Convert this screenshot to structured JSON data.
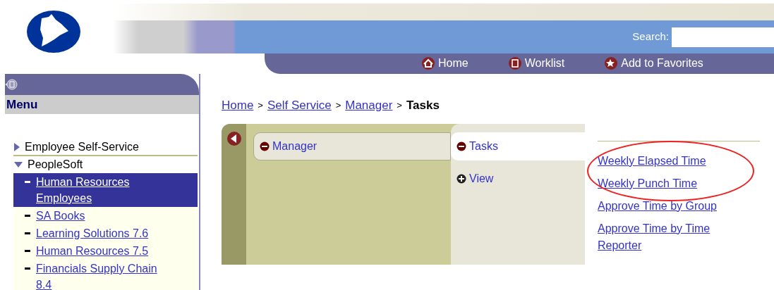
{
  "header": {
    "search": {
      "label": "Search:"
    }
  },
  "nav": [
    {
      "label": "Home",
      "kind": "home"
    },
    {
      "label": "Worklist",
      "kind": "worklist"
    },
    {
      "label": "Add to Favorites",
      "kind": "favorites"
    }
  ],
  "sidebar": {
    "title": "Menu",
    "items": [
      {
        "label": "Employee Self-Service",
        "expanded": false
      },
      {
        "label": "PeopleSoft",
        "expanded": true,
        "children": [
          {
            "label": "Human Resources Employees",
            "selected": true
          },
          {
            "label": "SA Books",
            "selected": false
          },
          {
            "label": "Learning Solutions 7.6",
            "selected": false
          },
          {
            "label": "Human Resources 7.5",
            "selected": false
          },
          {
            "label": "Financials Supply Chain 8.4",
            "selected": false
          }
        ]
      }
    ]
  },
  "breadcrumb": [
    {
      "label": "Home",
      "kind": "link"
    },
    {
      "label": ">",
      "kind": "separator"
    },
    {
      "label": "Self Service",
      "kind": "link"
    },
    {
      "label": ">",
      "kind": "separator"
    },
    {
      "label": "Manager",
      "kind": "link"
    },
    {
      "label": ">",
      "kind": "separator"
    },
    {
      "label": "Tasks",
      "kind": "current"
    }
  ],
  "columns": [
    {
      "folders": [
        {
          "label": "Manager",
          "expanded": true,
          "selected": false
        }
      ]
    },
    {
      "folders": [
        {
          "label": "Tasks",
          "expanded": true,
          "selected": true
        },
        {
          "label": "View",
          "expanded": false,
          "selected": false
        }
      ]
    }
  ],
  "tasks": [
    {
      "label": "Weekly Elapsed Time",
      "highlighted": true
    },
    {
      "label": "Weekly Punch Time",
      "highlighted": true
    },
    {
      "label": "Approve Time by Group",
      "highlighted": false
    },
    {
      "label": "Approve Time by Time Reporter",
      "highlighted": false
    }
  ]
}
